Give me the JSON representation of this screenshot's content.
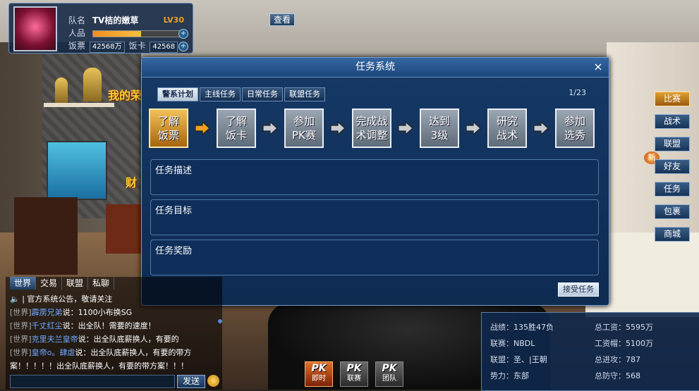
{
  "player": {
    "team_label": "队名",
    "team_name": "TV桔的嫩草",
    "level": "LV30",
    "popularity_label": "人品",
    "popularity_fill": 0.55,
    "meal_ticket_label": "饭票",
    "meal_ticket_value": "42568万",
    "meal_card_label": "饭卡",
    "meal_card_value": "42568"
  },
  "view_button": "查看",
  "scene_text": {
    "wall_sign_1": "我的荣",
    "wall_sign_2": "财"
  },
  "side_menu": [
    {
      "label": "比赛",
      "active": true
    },
    {
      "label": "战术"
    },
    {
      "label": "联盟"
    },
    {
      "label": "好友"
    },
    {
      "label": "任务"
    },
    {
      "label": "包裹"
    },
    {
      "label": "商城"
    }
  ],
  "new_badge": "新",
  "dialog": {
    "title": "任务系统",
    "close_glyph": "×",
    "tabs": [
      "警系计划",
      "主线任务",
      "日常任务",
      "联盟任务"
    ],
    "page": "1/23",
    "steps": [
      {
        "line1": "了解",
        "line2": "饭票",
        "active": true
      },
      {
        "line1": "了解",
        "line2": "饭卡"
      },
      {
        "line1": "参加",
        "line2": "PK赛"
      },
      {
        "line1": "完成战",
        "line2": "术调整"
      },
      {
        "line1": "达到",
        "line2": "3级"
      },
      {
        "line1": "研究",
        "line2": "战术"
      },
      {
        "line1": "参加",
        "line2": "选秀"
      }
    ],
    "sections": {
      "description": "任务描述",
      "goal": "任务目标",
      "reward": "任务奖励"
    },
    "accept_button": "接受任务"
  },
  "chat": {
    "tabs": [
      "世界",
      "交易",
      "联盟",
      "私聊"
    ],
    "announcement_icon": "speaker-icon",
    "announcement": "官方系统公告，敬请关注",
    "lines": [
      {
        "channel": "[世界]",
        "speaker": "霹雳兄弟",
        "text": "说：1100小布换SG"
      },
      {
        "channel": "[世界]",
        "speaker": "千丈红尘",
        "text": "说：出全队！需要的速度！"
      },
      {
        "channel": "[世界]",
        "speaker": "克里夫兰皇帝",
        "text": "说：出全队底薪换人，有要的"
      },
      {
        "channel": "[世界]",
        "speaker": "皇帝o。肆虐",
        "text": "说：出全队底薪换人，有要的带方"
      },
      {
        "channel": "",
        "speaker": "",
        "text": "案！！！！！出全队底薪换人，有要的带方案！！！"
      }
    ],
    "send_button": "发送"
  },
  "pk_buttons": [
    {
      "logo": "PK",
      "label": "即时",
      "highlight": true
    },
    {
      "logo": "PK",
      "label": "联赛"
    },
    {
      "logo": "PK",
      "label": "团队"
    }
  ],
  "stats": {
    "record_label": "战绩：",
    "record_value": "135胜47负",
    "league_label": "联赛：",
    "league_value": "NBDL",
    "alliance_label": "联盟：",
    "alliance_value": "圣、|王朝",
    "force_label": "势力：",
    "force_value": "东部",
    "total_salary_label": "总工资：",
    "total_salary_value": "5595万",
    "salary_cap_label": "工资帽：",
    "salary_cap_value": "5100万",
    "total_offense_label": "总进攻：",
    "total_offense_value": "787",
    "total_defense_label": "总防守：",
    "total_defense_value": "568"
  }
}
